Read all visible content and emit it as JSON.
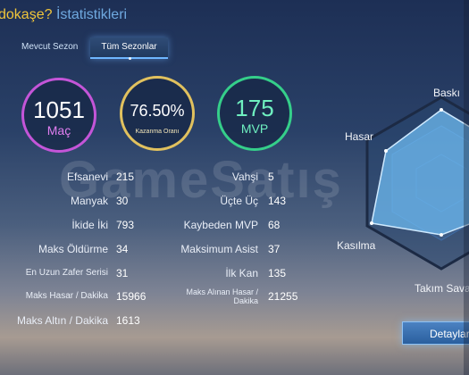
{
  "header": {
    "title_highlight": "dokaşe?",
    "title_rest": "İstatistikleri"
  },
  "tabs": [
    {
      "label": "Mevcut Sezon"
    },
    {
      "label": "Tüm Sezonlar"
    }
  ],
  "summary": {
    "matches": {
      "value": "1051",
      "label": "Maç"
    },
    "win_rate": {
      "value": "76.50%",
      "label": "Kazanma Oranı"
    },
    "mvp": {
      "value": "175",
      "label": "MVP"
    }
  },
  "stats_left": [
    {
      "label": "Efsanevi",
      "value": "215"
    },
    {
      "label": "Manyak",
      "value": "30"
    },
    {
      "label": "İkide İki",
      "value": "793"
    },
    {
      "label": "Maks Öldürme",
      "value": "34"
    },
    {
      "label": "En Uzun Zafer Serisi",
      "value": "31"
    },
    {
      "label": "Maks Hasar / Dakika",
      "value": "15966"
    },
    {
      "label": "Maks Altın / Dakika",
      "value": "1613"
    }
  ],
  "stats_right": [
    {
      "label": "Vahşi",
      "value": "5"
    },
    {
      "label": "Üçte Üç",
      "value": "143"
    },
    {
      "label": "Kaybeden MVP",
      "value": "68"
    },
    {
      "label": "Maksimum Asist",
      "value": "37"
    },
    {
      "label": "İlk Kan",
      "value": "135"
    },
    {
      "label": "Maks Alınan Hasar / Dakika",
      "value": "21255"
    }
  ],
  "radar": {
    "labels": {
      "top": "Baskı",
      "left_top": "Hasar",
      "left_bottom": "Kasılma",
      "bottom": "Takım Sava"
    }
  },
  "watermark": "GameSatış",
  "buttons": {
    "details": "Detaylar"
  },
  "colors": {
    "matches": "#c455d8",
    "win_rate": "#e1c15e",
    "mvp": "#35cf8a",
    "accent": "#6fb6ff"
  }
}
